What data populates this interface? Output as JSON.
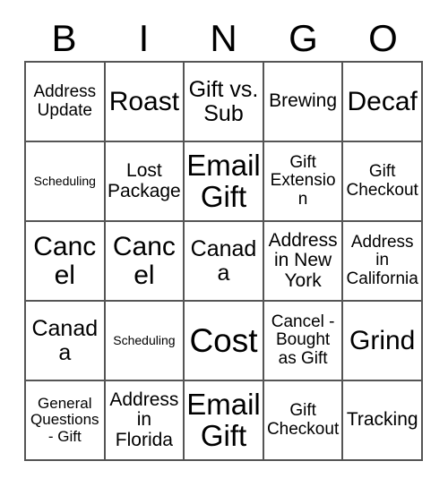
{
  "card": {
    "header_letters": [
      "B",
      "I",
      "N",
      "G",
      "O"
    ],
    "columns": 5,
    "rows": 5,
    "border_color": "#555555",
    "text_color": "#000000",
    "background_color": "#ffffff",
    "cells": [
      {
        "text": "Address Update",
        "size": "s-md"
      },
      {
        "text": "Roast",
        "size": "s-2xl"
      },
      {
        "text": "Gift vs. Sub",
        "size": "s-xl"
      },
      {
        "text": "Brewing",
        "size": "s-lg"
      },
      {
        "text": "Decaf",
        "size": "s-2xl"
      },
      {
        "text": "Scheduling",
        "size": "s-xs"
      },
      {
        "text": "Lost Package",
        "size": "s-lg"
      },
      {
        "text": "Email Gift",
        "size": "s-3xl"
      },
      {
        "text": "Gift Extension",
        "size": "s-md"
      },
      {
        "text": "Gift Checkout",
        "size": "s-md"
      },
      {
        "text": "Cancel",
        "size": "s-2xl"
      },
      {
        "text": "Cancel",
        "size": "s-2xl"
      },
      {
        "text": "Canada",
        "size": "s-xl"
      },
      {
        "text": "Address in New York",
        "size": "s-lg"
      },
      {
        "text": "Address in California",
        "size": "s-md"
      },
      {
        "text": "Canada",
        "size": "s-xl"
      },
      {
        "text": "Scheduling",
        "size": "s-xs"
      },
      {
        "text": "Cost",
        "size": "s-4xl"
      },
      {
        "text": "Cancel - Bought as Gift",
        "size": "s-md"
      },
      {
        "text": "Grind",
        "size": "s-2xl"
      },
      {
        "text": "General Questions - Gift",
        "size": "s-sm"
      },
      {
        "text": "Address in Florida",
        "size": "s-lg"
      },
      {
        "text": "Email Gift",
        "size": "s-3xl"
      },
      {
        "text": "Gift Checkout",
        "size": "s-md"
      },
      {
        "text": "Tracking",
        "size": "s-lg"
      }
    ]
  }
}
